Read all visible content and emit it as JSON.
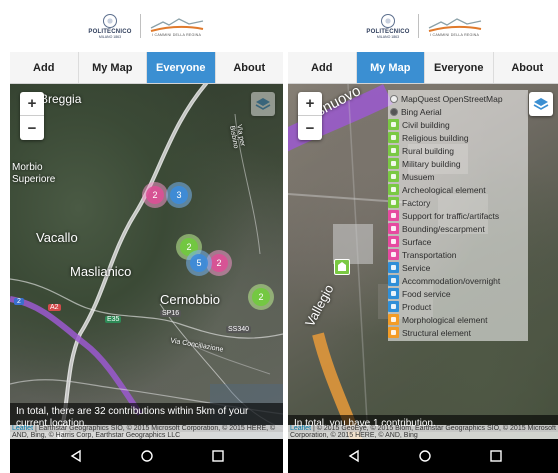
{
  "brand": {
    "university": "POLITECNICO",
    "university_sub": "MILANO 1863",
    "project": "I CAMMINI DELLA REGINA"
  },
  "tabs": [
    "Add",
    "My Map",
    "Everyone",
    "About"
  ],
  "screens": {
    "left": {
      "active_tab": "Everyone",
      "places": [
        "Breggia",
        "Morbio Superiore",
        "Vacallo",
        "Maslianico",
        "Cernobbio",
        "Via per Bisbino",
        "Via Conciliazione"
      ],
      "road_labels": [
        "A2",
        "E35",
        "SP16",
        "SS340",
        "2"
      ],
      "clusters": [
        "2",
        "3",
        "2",
        "2",
        "5",
        "2"
      ],
      "info_text": "In total, there are 32 contributions within 5km of your current location.",
      "attribution": "| Earthstar Geographics SIO, © 2015 Microsoft Corporation, © 2015 HERE, © AND, Bing, © Harris Corp, Earthstar Geographics LLC"
    },
    "right": {
      "active_tab": "My Map",
      "places": [
        "Casnuovo",
        "Vallegio"
      ],
      "base_layers": [
        "MapQuest OpenStreetMap",
        "Bing Aerial"
      ],
      "overlays": [
        {
          "label": "Civil building",
          "color": "#7ac943"
        },
        {
          "label": "Religious building",
          "color": "#7ac943"
        },
        {
          "label": "Rural building",
          "color": "#7ac943"
        },
        {
          "label": "Military building",
          "color": "#7ac943"
        },
        {
          "label": "Musuem",
          "color": "#7ac943"
        },
        {
          "label": "Archeological element",
          "color": "#7ac943"
        },
        {
          "label": "Factory",
          "color": "#7ac943"
        },
        {
          "label": "Support for traffic/artifacts",
          "color": "#e64aa0"
        },
        {
          "label": "Bounding/escarpment",
          "color": "#e64aa0"
        },
        {
          "label": "Surface",
          "color": "#e64aa0"
        },
        {
          "label": "Transportation",
          "color": "#e64aa0"
        },
        {
          "label": "Service",
          "color": "#2f8fd8"
        },
        {
          "label": "Accommodation/overnight",
          "color": "#2f8fd8"
        },
        {
          "label": "Food service",
          "color": "#2f8fd8"
        },
        {
          "label": "Product",
          "color": "#2f8fd8"
        },
        {
          "label": "Morphological element",
          "color": "#f39c26"
        },
        {
          "label": "Structural element",
          "color": "#f39c26"
        }
      ],
      "info_text": "In total, you have 1 contribution.",
      "attribution": "| © 2015 GeoEye, © 2015 Blom, Earthstar Geographics SIO, © 2015 Microsoft Corporation, © 2015 HERE, © AND, Bing"
    }
  },
  "leaflet": "Leaflet",
  "zoom": {
    "in": "+",
    "out": "−"
  },
  "colors": {
    "accent": "#3b8fd2",
    "cluster_green": "#6ecc39",
    "cluster_blue": "#3c8cdc",
    "cluster_pink": "#dc5096",
    "route": "#9b59d0"
  },
  "icons": [
    "politecnico-seal-icon",
    "cammini-mountain-icon",
    "layers-icon",
    "back-icon",
    "home-icon",
    "recents-icon"
  ]
}
